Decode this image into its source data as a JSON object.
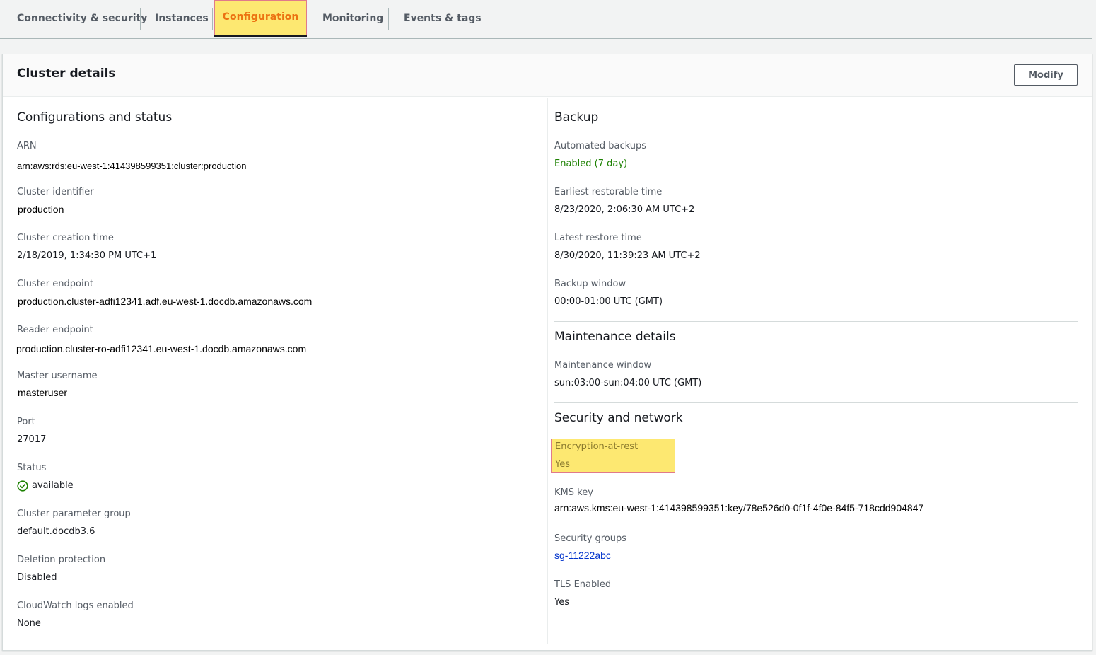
{
  "tabs": [
    {
      "label": "Connectivity & security"
    },
    {
      "label": "Instances"
    },
    {
      "label": "Configuration"
    },
    {
      "label": "Monitoring"
    },
    {
      "label": "Events & tags"
    }
  ],
  "active_tab": "Configuration",
  "panel": {
    "title": "Cluster details",
    "modify_label": "Modify"
  },
  "left": {
    "section_title": "Configurations and status",
    "fields": {
      "arn": {
        "label": "ARN",
        "value": "arn:aws:rds:eu-west-1:414398599351:cluster:production"
      },
      "cluster_identifier": {
        "label": "Cluster identifier",
        "value": "production"
      },
      "cluster_creation_time": {
        "label": "Cluster creation time",
        "value": "2/18/2019, 1:34:30 PM UTC+1"
      },
      "cluster_endpoint": {
        "label": "Cluster endpoint",
        "value": "production.cluster-adfi12341.adf.eu-west-1.docdb.amazonaws.com"
      },
      "reader_endpoint": {
        "label": "Reader endpoint",
        "value": "production.cluster-ro-adfi12341.eu-west-1.docdb.amazonaws.com"
      },
      "master_username": {
        "label": "Master username",
        "value": "masteruser"
      },
      "port": {
        "label": "Port",
        "value": "27017"
      },
      "status": {
        "label": "Status",
        "value": "available",
        "icon": "check-circle-icon",
        "color": "#1d8102"
      },
      "cluster_parameter_group": {
        "label": "Cluster parameter group",
        "value": "default.docdb3.6"
      },
      "deletion_protection": {
        "label": "Deletion protection",
        "value": "Disabled"
      },
      "cloudwatch_logs": {
        "label": "CloudWatch logs enabled",
        "value": "None"
      }
    }
  },
  "right": {
    "backup": {
      "section_title": "Backup",
      "automated_backups": {
        "label": "Automated backups",
        "value": "Enabled (7 day)",
        "color": "#1d8102"
      },
      "earliest_restorable_time": {
        "label": "Earliest restorable time",
        "value": "8/23/2020, 2:06:30 AM UTC+2"
      },
      "latest_restore_time": {
        "label": "Latest restore time",
        "value": "8/30/2020, 11:39:23 AM UTC+2"
      },
      "backup_window": {
        "label": "Backup window",
        "value": "00:00-01:00 UTC (GMT)"
      }
    },
    "maintenance": {
      "section_title": "Maintenance details",
      "maintenance_window": {
        "label": "Maintenance window",
        "value": "sun:03:00-sun:04:00 UTC (GMT)"
      }
    },
    "security": {
      "section_title": "Security and network",
      "encryption_at_rest": {
        "label": "Encryption-at-rest",
        "value": "Yes"
      },
      "kms_key": {
        "label": "KMS key",
        "value": "arn:aws.kms:eu-west-1:414398599351:key/78e526d0-0f1f-4f0e-84f5-718cdd904847"
      },
      "security_groups": {
        "label": "Security groups",
        "value": "sg-11222abc"
      },
      "tls_enabled": {
        "label": "TLS Enabled",
        "value": "Yes"
      }
    }
  },
  "colors": {
    "highlight": "#fde871",
    "highlight_border": "#e07a8a",
    "active_tab_text": "#ec7211",
    "link": "#0033cc"
  }
}
